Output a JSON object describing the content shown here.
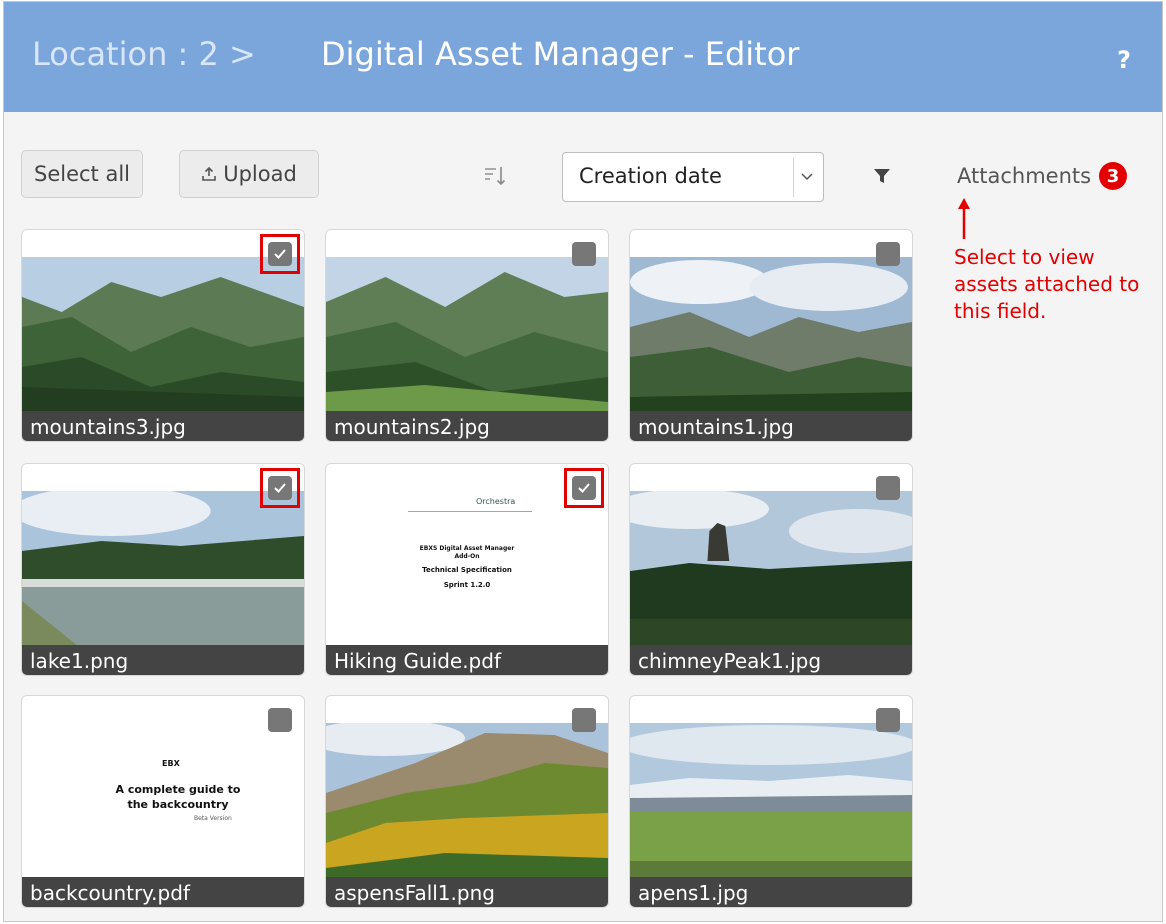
{
  "header": {
    "location_label": "Location",
    "location_sep": ":",
    "location_value": "2",
    "crumb_sep": ">",
    "title": "Digital Asset Manager - Editor",
    "help_label": "?"
  },
  "toolbar": {
    "select_all_label": "Select all",
    "upload_label": "Upload",
    "sort_selected": "Creation date",
    "attachments_label": "Attachments",
    "attachments_count": "3"
  },
  "annotation": {
    "text": "Select to view assets attached to this field."
  },
  "assets": [
    {
      "name": "mountains3.jpg",
      "selected": true
    },
    {
      "name": "mountains2.jpg",
      "selected": false
    },
    {
      "name": "mountains1.jpg",
      "selected": false
    },
    {
      "name": "lake1.png",
      "selected": true
    },
    {
      "name": "Hiking Guide.pdf",
      "selected": true
    },
    {
      "name": "chimneyPeak1.jpg",
      "selected": false
    },
    {
      "name": "backcountry.pdf",
      "selected": false
    },
    {
      "name": "aspensFall1.png",
      "selected": false
    },
    {
      "name": "apens1.jpg",
      "selected": false
    }
  ],
  "documents": {
    "hiking_guide": {
      "logo_text": "Orchestra",
      "line1": "EBXS Digital Asset Manager",
      "line2": "Add-On",
      "line3": "Technical Specification",
      "line4": "Sprint 1.2.0"
    },
    "backcountry": {
      "line1": "EBX",
      "line2": "A complete guide to",
      "line3": "the backcountry",
      "line4": "Beta Version"
    }
  },
  "colors": {
    "header_bg": "#7ba6dc",
    "accent_red": "#e30000",
    "label_bar": "#444444"
  }
}
